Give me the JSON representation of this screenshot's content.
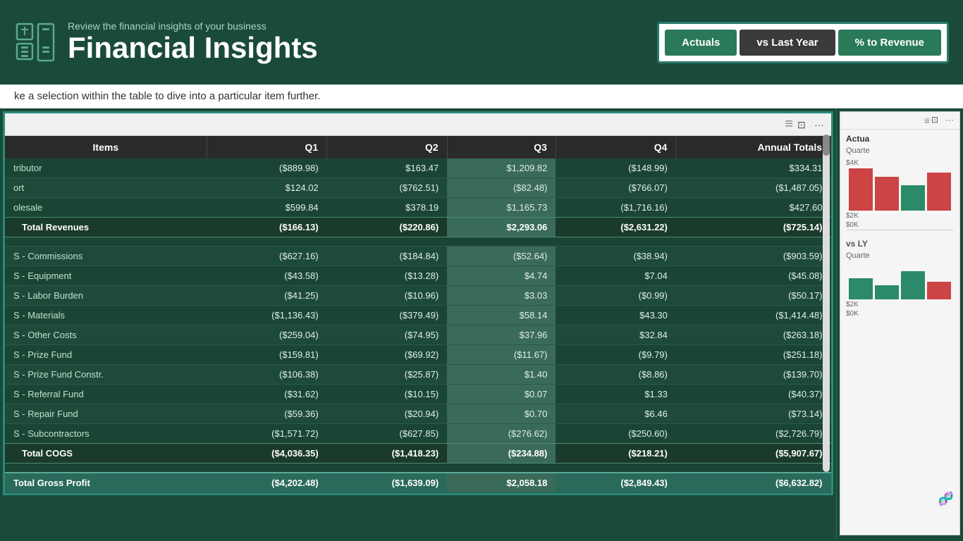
{
  "header": {
    "subtitle": "Review the financial insights of your business",
    "title": "Financial Insights"
  },
  "toggle_panel": {
    "buttons": [
      {
        "label": "Actuals",
        "state": "active"
      },
      {
        "label": "vs Last Year",
        "state": "inactive"
      },
      {
        "label": "% to Revenue",
        "state": "active"
      }
    ]
  },
  "subtitle_bar": {
    "text": "ke a selection within the table to dive into a particular item further."
  },
  "table": {
    "columns": [
      "Items",
      "Q1",
      "Q2",
      "Q3",
      "Q4",
      "Annual Totals"
    ],
    "rows": [
      {
        "item": "tributor",
        "q1": "($889.98)",
        "q2": "$163.47",
        "q3": "$1,209.82",
        "q4": "($148.99)",
        "total": "$334.31",
        "type": "data"
      },
      {
        "item": "ort",
        "q1": "$124.02",
        "q2": "($762.51)",
        "q3": "($82.48)",
        "q4": "($766.07)",
        "total": "($1,487.05)",
        "type": "data"
      },
      {
        "item": "olesale",
        "q1": "$599.84",
        "q2": "$378.19",
        "q3": "$1,165.73",
        "q4": "($1,716.16)",
        "total": "$427.60",
        "type": "data"
      },
      {
        "item": "    Total Revenues",
        "q1": "($166.13)",
        "q2": "($220.86)",
        "q3": "$2,293.06",
        "q4": "($2,631.22)",
        "total": "($725.14)",
        "type": "total"
      },
      {
        "item": "",
        "q1": "",
        "q2": "",
        "q3": "",
        "q4": "",
        "total": "",
        "type": "spacer"
      },
      {
        "item": "S - Commissions",
        "q1": "($627.16)",
        "q2": "($184.84)",
        "q3": "($52.64)",
        "q4": "($38.94)",
        "total": "($903.59)",
        "type": "data"
      },
      {
        "item": "S - Equipment",
        "q1": "($43.58)",
        "q2": "($13.28)",
        "q3": "$4.74",
        "q4": "$7.04",
        "total": "($45.08)",
        "type": "data"
      },
      {
        "item": "S - Labor Burden",
        "q1": "($41.25)",
        "q2": "($10.96)",
        "q3": "$3.03",
        "q4": "($0.99)",
        "total": "($50.17)",
        "type": "data"
      },
      {
        "item": "S - Materials",
        "q1": "($1,136.43)",
        "q2": "($379.49)",
        "q3": "$58.14",
        "q4": "$43.30",
        "total": "($1,414.48)",
        "type": "data"
      },
      {
        "item": "S - Other Costs",
        "q1": "($259.04)",
        "q2": "($74.95)",
        "q3": "$37.96",
        "q4": "$32.84",
        "total": "($263.18)",
        "type": "data"
      },
      {
        "item": "S - Prize Fund",
        "q1": "($159.81)",
        "q2": "($69.92)",
        "q3": "($11.67)",
        "q4": "($9.79)",
        "total": "($251.18)",
        "type": "data"
      },
      {
        "item": "S - Prize Fund Constr.",
        "q1": "($106.38)",
        "q2": "($25.87)",
        "q3": "$1.40",
        "q4": "($8.86)",
        "total": "($139.70)",
        "type": "data"
      },
      {
        "item": "S - Referral Fund",
        "q1": "($31.62)",
        "q2": "($10.15)",
        "q3": "$0.07",
        "q4": "$1.33",
        "total": "($40.37)",
        "type": "data"
      },
      {
        "item": "S - Repair Fund",
        "q1": "($59.36)",
        "q2": "($20.94)",
        "q3": "$0.70",
        "q4": "$6.46",
        "total": "($73.14)",
        "type": "data"
      },
      {
        "item": "S - Subcontractors",
        "q1": "($1,571.72)",
        "q2": "($627.85)",
        "q3": "($276.62)",
        "q4": "($250.60)",
        "total": "($2,726.79)",
        "type": "data"
      },
      {
        "item": "    Total COGS",
        "q1": "($4,036.35)",
        "q2": "($1,418.23)",
        "q3": "($234.88)",
        "q4": "($218.21)",
        "total": "($5,907.67)",
        "type": "total"
      },
      {
        "item": "",
        "q1": "",
        "q2": "",
        "q3": "",
        "q4": "",
        "total": "",
        "type": "spacer"
      },
      {
        "item": "Total Gross Profit",
        "q1": "($4,202.48)",
        "q2": "($1,639.09)",
        "q3": "$2,058.18",
        "q4": "($2,849.43)",
        "total": "($6,632.82)",
        "type": "gross"
      }
    ]
  },
  "sidebar": {
    "actuals_label": "Actua",
    "quarter_label": "Quarte",
    "value_4k": "$4K",
    "value_2k": "$2K",
    "value_0k": "$0K",
    "vs_ly_label": "vs LY",
    "quarter_label2": "Quarte",
    "value_neg2k": "$2K",
    "value_neg0k": "$0K"
  },
  "window_controls": {
    "separator": "≡",
    "expand": "⬜",
    "more": "···"
  }
}
